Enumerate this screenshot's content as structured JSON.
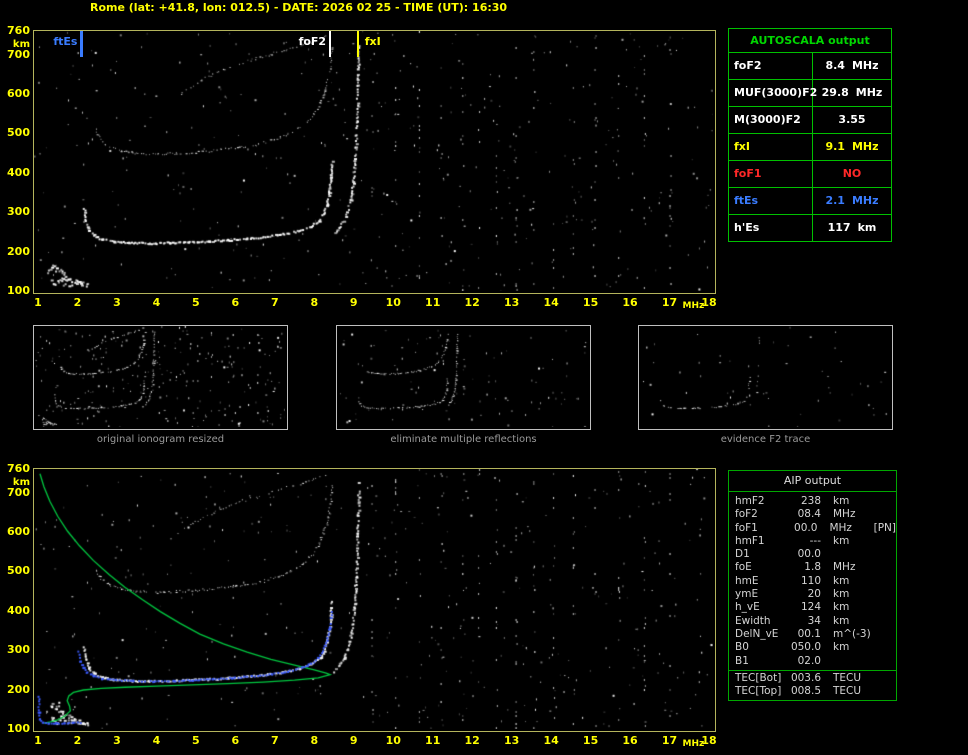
{
  "title": "Rome (lat: +41.8, lon: 012.5) - DATE: 2026 02 25 - TIME (UT): 16:30",
  "colors": {
    "background": "#000000",
    "axis_text": "#ffff00",
    "plot_border": "#b4b45c",
    "table_border_green": "#00c000",
    "trace_white": "#ffffff",
    "profile_green": "#00c840",
    "scaled_trace_blue": "#3b5bff",
    "ftes_blue": "#3a7cff",
    "fxi_yellow": "#ffff00",
    "fof1_red": "#ff2828",
    "caption_gray": "#9a9a9a"
  },
  "axes": {
    "y_unit": "km",
    "x_unit": "MHz",
    "y_ticks": [
      760,
      700,
      600,
      500,
      400,
      300,
      200,
      100
    ],
    "x_ticks": [
      1,
      2,
      3,
      4,
      5,
      6,
      7,
      8,
      9,
      10,
      11,
      12,
      13,
      14,
      15,
      16,
      17,
      18
    ],
    "x_range": [
      1,
      18
    ],
    "y_range": [
      100,
      760
    ]
  },
  "top_plot": {
    "markers": [
      {
        "label": "ftEs",
        "freq_mhz": 2.1,
        "color": "#3a7cff",
        "side": "left"
      },
      {
        "label": "foF2",
        "freq_mhz": 8.4,
        "color": "#ffffff",
        "side": "left"
      },
      {
        "label": "fxI",
        "freq_mhz": 9.1,
        "color": "#ffff00",
        "side": "right"
      }
    ]
  },
  "autoscala_table": {
    "title": "AUTOSCALA output",
    "rows": [
      {
        "label": "foF2",
        "value": "8.4",
        "unit": "MHz",
        "color": "#ffffff"
      },
      {
        "label": "MUF(3000)F2",
        "value": "29.8",
        "unit": "MHz",
        "color": "#ffffff"
      },
      {
        "label": "M(3000)F2",
        "value": "3.55",
        "unit": "",
        "color": "#ffffff"
      },
      {
        "label": "fxI",
        "value": "9.1",
        "unit": "MHz",
        "color": "#ffff00"
      },
      {
        "label": "foF1",
        "value": "NO",
        "unit": "",
        "color": "#ff2828"
      },
      {
        "label": "ftEs",
        "value": "2.1",
        "unit": "MHz",
        "color": "#3a7cff"
      },
      {
        "label": "h'Es",
        "value": "117",
        "unit": "km",
        "color": "#ffffff"
      }
    ]
  },
  "thumbnails": [
    {
      "caption": "original ionogram resized"
    },
    {
      "caption": "eliminate multiple reflections"
    },
    {
      "caption": "evidence F2 trace"
    }
  ],
  "aip_table": {
    "title": "AIP output",
    "rows": [
      {
        "label": "hmF2",
        "value": "238",
        "unit": "km",
        "extra": ""
      },
      {
        "label": "foF2",
        "value": "08.4",
        "unit": "MHz",
        "extra": ""
      },
      {
        "label": "foF1",
        "value": "00.0",
        "unit": "MHz",
        "extra": "[PN]"
      },
      {
        "label": "hmF1",
        "value": "---",
        "unit": "km",
        "extra": ""
      },
      {
        "label": "D1",
        "value": "00.0",
        "unit": "",
        "extra": ""
      },
      {
        "label": "foE",
        "value": "1.8",
        "unit": "MHz",
        "extra": ""
      },
      {
        "label": "hmE",
        "value": "110",
        "unit": "km",
        "extra": ""
      },
      {
        "label": "ymE",
        "value": "20",
        "unit": "km",
        "extra": ""
      },
      {
        "label": "h_vE",
        "value": "124",
        "unit": "km",
        "extra": ""
      },
      {
        "label": "Ewidth",
        "value": "34",
        "unit": "km",
        "extra": ""
      },
      {
        "label": "DelN_vE",
        "value": "00.1",
        "unit": "m^(-3)",
        "extra": ""
      },
      {
        "label": "B0",
        "value": "050.0",
        "unit": "km",
        "extra": ""
      },
      {
        "label": "B1",
        "value": "02.0",
        "unit": "",
        "extra": ""
      }
    ],
    "tec_rows": [
      {
        "label": "TEC[Bot]",
        "value": "003.6",
        "unit": "TECU"
      },
      {
        "label": "TEC[Top]",
        "value": "008.5",
        "unit": "TECU"
      }
    ]
  },
  "chart_data": {
    "type": "scatter",
    "title": "Ionogram, Rome, 2026-02-25 16:30 UT",
    "xlabel": "MHz",
    "ylabel": "km",
    "xlim": [
      1,
      18
    ],
    "ylim": [
      100,
      760
    ],
    "markers": [
      {
        "label": "ftEs",
        "x": 2.1
      },
      {
        "label": "foF2",
        "x": 8.4
      },
      {
        "label": "fxI",
        "x": 9.1
      }
    ],
    "scaled_values": {
      "foF2_MHz": 8.4,
      "MUF3000F2_MHz": 29.8,
      "M3000F2": 3.55,
      "fxI_MHz": 9.1,
      "foF1": "NO",
      "ftEs_MHz": 2.1,
      "hEs_km": 117,
      "hmF2_km": 238
    },
    "traces": {
      "es_layer": [
        [
          1.25,
          152
        ],
        [
          1.35,
          160
        ],
        [
          1.45,
          165
        ],
        [
          1.5,
          150
        ],
        [
          1.62,
          142
        ],
        [
          1.56,
          130
        ],
        [
          1.7,
          136
        ],
        [
          1.82,
          128
        ],
        [
          1.95,
          123
        ],
        [
          2.1,
          120
        ],
        [
          2.25,
          118
        ],
        [
          1.38,
          122
        ],
        [
          1.3,
          133
        ]
      ],
      "f2_omode": [
        [
          2.15,
          310
        ],
        [
          2.2,
          278
        ],
        [
          2.28,
          256
        ],
        [
          2.4,
          243
        ],
        [
          2.6,
          233
        ],
        [
          2.9,
          227
        ],
        [
          3.3,
          224
        ],
        [
          3.8,
          223
        ],
        [
          4.3,
          224
        ],
        [
          4.8,
          226
        ],
        [
          5.3,
          228
        ],
        [
          5.8,
          231
        ],
        [
          6.3,
          235
        ],
        [
          6.8,
          240
        ],
        [
          7.2,
          246
        ],
        [
          7.6,
          255
        ],
        [
          7.9,
          266
        ],
        [
          8.1,
          280
        ],
        [
          8.22,
          298
        ],
        [
          8.3,
          322
        ],
        [
          8.36,
          352
        ],
        [
          8.4,
          390
        ],
        [
          8.43,
          430
        ]
      ],
      "f2_xmode": [
        [
          8.5,
          248
        ],
        [
          8.6,
          262
        ],
        [
          8.72,
          280
        ],
        [
          8.82,
          303
        ],
        [
          8.9,
          332
        ],
        [
          8.96,
          368
        ],
        [
          9.0,
          412
        ],
        [
          9.03,
          465
        ],
        [
          9.06,
          530
        ],
        [
          9.08,
          600
        ],
        [
          9.1,
          668
        ],
        [
          9.11,
          725
        ]
      ],
      "second_hop": [
        [
          2.45,
          505
        ],
        [
          2.6,
          482
        ],
        [
          2.8,
          466
        ],
        [
          3.1,
          456
        ],
        [
          3.5,
          450
        ],
        [
          4.0,
          448
        ],
        [
          4.5,
          450
        ],
        [
          5.0,
          453
        ],
        [
          5.5,
          458
        ],
        [
          6.0,
          464
        ],
        [
          6.5,
          472
        ],
        [
          6.9,
          483
        ],
        [
          7.3,
          497
        ],
        [
          7.65,
          517
        ],
        [
          7.95,
          545
        ],
        [
          8.15,
          580
        ],
        [
          8.3,
          622
        ],
        [
          8.4,
          672
        ],
        [
          8.45,
          718
        ]
      ],
      "third_hop": [
        [
          4.55,
          598
        ],
        [
          4.9,
          622
        ],
        [
          5.3,
          645
        ],
        [
          5.7,
          663
        ],
        [
          6.1,
          678
        ],
        [
          6.5,
          691
        ],
        [
          6.9,
          703
        ],
        [
          7.3,
          714
        ],
        [
          7.7,
          726
        ],
        [
          8.05,
          737
        ],
        [
          8.3,
          747
        ]
      ],
      "profile": [
        [
          1.05,
          748
        ],
        [
          1.15,
          715
        ],
        [
          1.3,
          678
        ],
        [
          1.5,
          640
        ],
        [
          1.75,
          602
        ],
        [
          2.05,
          565
        ],
        [
          2.4,
          528
        ],
        [
          2.8,
          492
        ],
        [
          3.2,
          460
        ],
        [
          3.65,
          428
        ],
        [
          4.1,
          398
        ],
        [
          4.6,
          368
        ],
        [
          5.1,
          341
        ],
        [
          5.7,
          316
        ],
        [
          6.3,
          295
        ],
        [
          6.9,
          277
        ],
        [
          7.5,
          262
        ],
        [
          8.0,
          250
        ],
        [
          8.3,
          242
        ],
        [
          8.4,
          238
        ],
        [
          8.1,
          230
        ],
        [
          7.5,
          224
        ],
        [
          6.7,
          219
        ],
        [
          5.8,
          215
        ],
        [
          4.9,
          212
        ],
        [
          4.0,
          209
        ],
        [
          3.2,
          206
        ],
        [
          2.6,
          203
        ],
        [
          2.15,
          199
        ],
        [
          1.9,
          193
        ],
        [
          1.78,
          184
        ],
        [
          1.74,
          172
        ],
        [
          1.8,
          158
        ],
        [
          1.82,
          146
        ],
        [
          1.68,
          133
        ],
        [
          1.5,
          123
        ],
        [
          1.32,
          118
        ],
        [
          1.15,
          115
        ]
      ],
      "scaled_f2": [
        [
          2.0,
          298
        ],
        [
          2.05,
          274
        ],
        [
          2.12,
          258
        ],
        [
          2.22,
          246
        ],
        [
          2.38,
          237
        ],
        [
          2.6,
          230
        ],
        [
          2.95,
          226
        ],
        [
          3.4,
          224
        ],
        [
          3.9,
          223
        ],
        [
          4.4,
          224
        ],
        [
          4.9,
          226
        ],
        [
          5.4,
          229
        ],
        [
          5.9,
          232
        ],
        [
          6.4,
          236
        ],
        [
          6.9,
          241
        ],
        [
          7.3,
          248
        ],
        [
          7.65,
          257
        ],
        [
          7.9,
          268
        ],
        [
          8.08,
          282
        ],
        [
          8.2,
          300
        ],
        [
          8.3,
          326
        ],
        [
          8.37,
          360
        ],
        [
          8.42,
          400
        ]
      ],
      "scaled_es": [
        [
          1.0,
          185
        ],
        [
          1.0,
          165
        ],
        [
          1.0,
          145
        ],
        [
          1.02,
          128
        ],
        [
          1.1,
          118
        ],
        [
          1.25,
          117
        ],
        [
          1.45,
          117
        ],
        [
          1.65,
          117
        ],
        [
          1.85,
          117
        ],
        [
          2.05,
          118
        ]
      ]
    },
    "noise": {
      "seed": 20260225,
      "count": 400,
      "rfi_columns": [
        9.45,
        10.05,
        10.65,
        11.2,
        11.75,
        12.15,
        12.6,
        13.1,
        13.55,
        14.05,
        14.55,
        15.1,
        15.7,
        16.35,
        17.0
      ]
    }
  }
}
